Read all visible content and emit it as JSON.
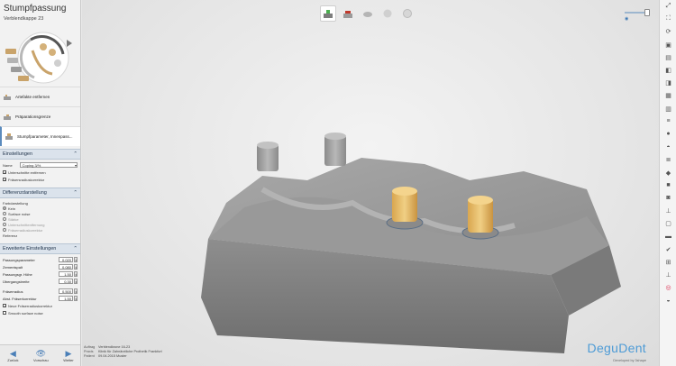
{
  "panel": {
    "title": "Stumpfpassung",
    "subtitle": "Verblendkappe 23"
  },
  "steps": [
    {
      "label": "Artefakte entfernen",
      "icon": "model-icon"
    },
    {
      "label": "Präparationsgrenze",
      "icon": "margin-icon"
    },
    {
      "label": "Stumpfparameter, Innenpass...",
      "icon": "die-params-icon"
    }
  ],
  "settings": {
    "header": "Einstellungen",
    "name_label": "Name",
    "name_value": "Coping 3/%",
    "checks": [
      {
        "label": "Unterschnitte entfernen",
        "checked": true
      },
      {
        "label": "Fräsersradiuskorrektur",
        "checked": true
      }
    ]
  },
  "difference": {
    "header": "Differenzdarstellung",
    "group_label": "Farbdarstellung",
    "options": [
      {
        "label": "Kein",
        "on": true
      },
      {
        "label": "Surface noise",
        "on": false
      },
      {
        "label": "Stärke",
        "on": false
      },
      {
        "label": "Unterschnittentfernung",
        "on": false
      },
      {
        "label": "Fräserradiuskorrektur",
        "on": false
      }
    ],
    "footer": "Referenz"
  },
  "advanced": {
    "header": "Erweiterte Einstellungen",
    "params": [
      {
        "label": "Passungsparameter",
        "value": "0.020"
      },
      {
        "label": "Zementspalt",
        "value": "0.080"
      },
      {
        "label": "Passungsgr. Höhe",
        "value": "1.50"
      },
      {
        "label": "Übergangsbreite",
        "value": "0.30"
      },
      {
        "label": "Fräserradius",
        "value": "0.500"
      },
      {
        "label": "Abst. Fräserkorrektur",
        "value": "1.50"
      }
    ],
    "checks": [
      {
        "label": "Neue Fräserradiuskorrektur",
        "checked": true
      },
      {
        "label": "Smooth surface noise",
        "checked": false
      }
    ]
  },
  "nav": {
    "back": "Zurück",
    "preview": "Vorschau",
    "next": "Weiter"
  },
  "info": {
    "rows": [
      {
        "k": "Auftrag",
        "v": "Verblendkrone 16-23"
      },
      {
        "k": "Praxis",
        "v": "Klinik für Zahnärztliche Prothetik Frankfurt"
      },
      {
        "k": "Patient",
        "v": "09.04.2015 Muster"
      }
    ]
  },
  "brand": {
    "logo": "DeguDent",
    "developed": "Developed by 3shape"
  },
  "colors": {
    "accent": "#4d9bd6",
    "header_bg": "#dbe3ec",
    "stump": "#e8bd6a"
  }
}
